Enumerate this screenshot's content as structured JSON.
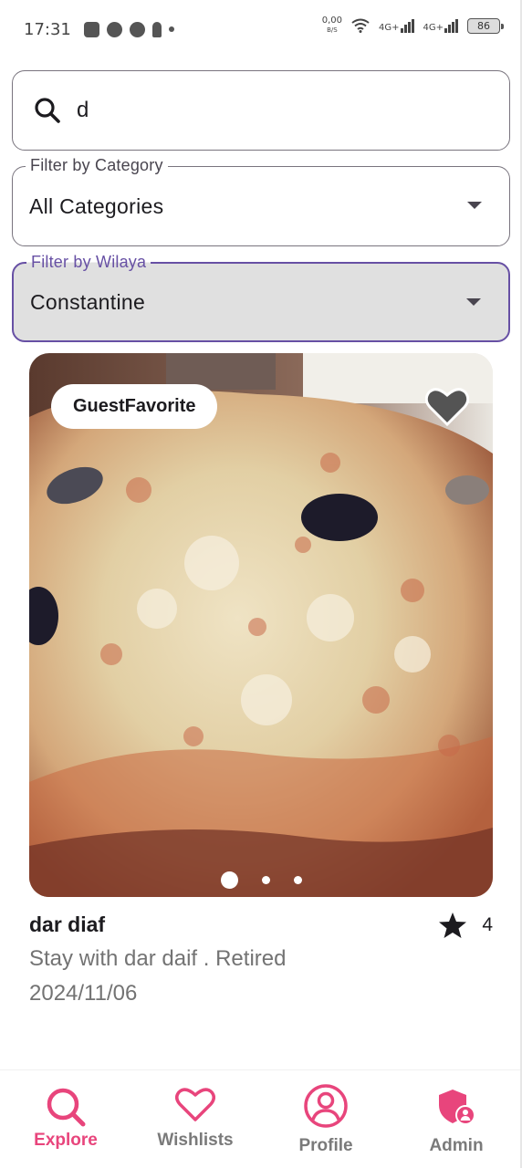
{
  "status_bar": {
    "time": "17:31",
    "net_speed": "0,00",
    "net_unit": "B/S",
    "signal_1": "4G+",
    "signal_2": "4G+",
    "battery": "86"
  },
  "search": {
    "value": "d",
    "icon": "search-icon"
  },
  "filters": {
    "category": {
      "label": "Filter by Category",
      "value": "All Categories"
    },
    "wilaya": {
      "label": "Filter by Wilaya",
      "value": "Constantine"
    }
  },
  "listing": {
    "badge": "GuestFavorite",
    "title": "dar diaf",
    "rating": "4",
    "description": "Stay with dar daif . Retired",
    "date": "2024/11/06",
    "image_count": 3,
    "active_image": 0
  },
  "bottom_nav": {
    "items": [
      {
        "label": "Explore",
        "icon": "search-icon",
        "active": true
      },
      {
        "label": "Wishlists",
        "icon": "heart-icon",
        "active": false
      },
      {
        "label": "Profile",
        "icon": "person-icon",
        "active": false
      },
      {
        "label": "Admin",
        "icon": "admin-shield-icon",
        "active": false
      }
    ]
  },
  "colors": {
    "accent": "#e8457c",
    "focus_border": "#6750a4",
    "muted_text": "#737373"
  }
}
